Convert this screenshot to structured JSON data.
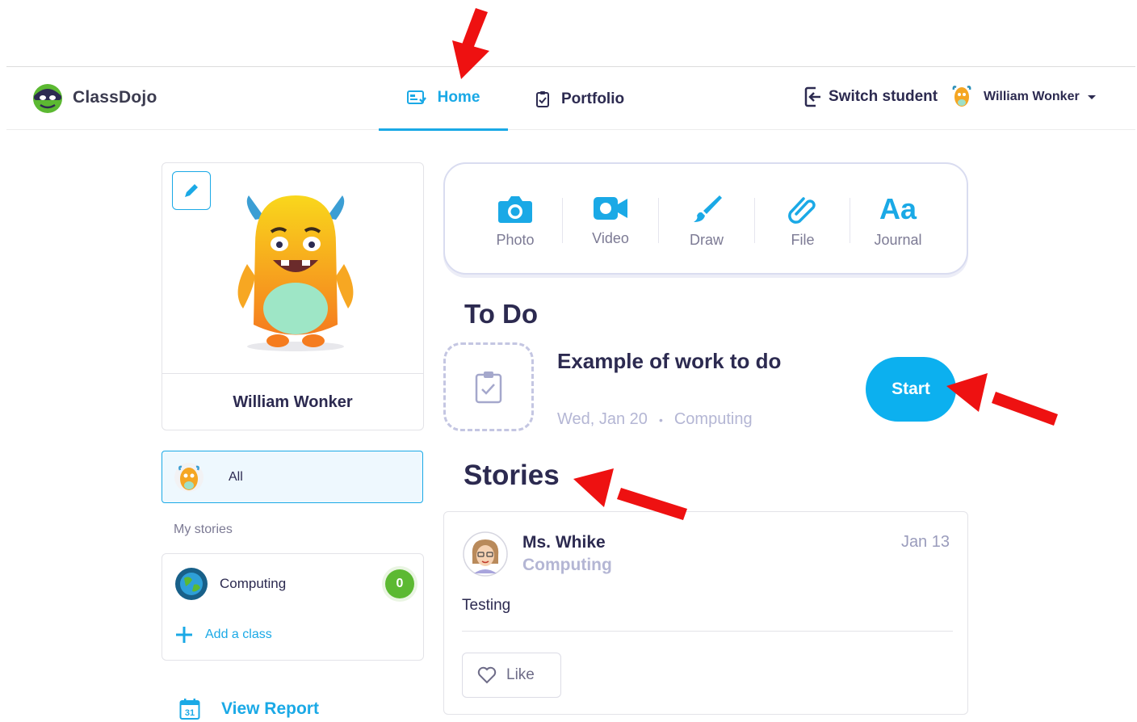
{
  "header": {
    "logo_text": "ClassDojo",
    "tabs": [
      {
        "label": "Home",
        "icon": "home-icon",
        "active": true
      },
      {
        "label": "Portfolio",
        "icon": "clipboard-icon",
        "active": false
      }
    ],
    "switch_student_label": "Switch student",
    "user_name": "William Wonker"
  },
  "profile": {
    "name": "William Wonker"
  },
  "filters": {
    "all_label": "All",
    "my_stories_label": "My stories",
    "classes": [
      {
        "name": "Computing",
        "count": "0"
      }
    ],
    "add_class_label": "Add a class",
    "view_report_label": "View Report",
    "calendar_day": "31"
  },
  "composer": {
    "tools": [
      {
        "label": "Photo",
        "icon": "camera-icon"
      },
      {
        "label": "Video",
        "icon": "video-camera-icon"
      },
      {
        "label": "Draw",
        "icon": "paintbrush-icon"
      },
      {
        "label": "File",
        "icon": "paperclip-icon"
      },
      {
        "label": "Journal",
        "icon": "text-aa-icon",
        "glyph": "Aa"
      }
    ]
  },
  "todo": {
    "title": "To Do",
    "item_title": "Example of work to do",
    "date": "Wed, Jan 20",
    "separator": "•",
    "class_name": "Computing",
    "start_label": "Start"
  },
  "stories": {
    "title": "Stories",
    "items": [
      {
        "author": "Ms. Whike",
        "class_name": "Computing",
        "date": "Jan 13",
        "text": "Testing",
        "like_label": "Like"
      }
    ]
  },
  "colors": {
    "accent": "#1aa9e6",
    "primary_text": "#2c2a50",
    "muted_text": "#b4b6d4",
    "badge_green": "#5cb932",
    "annotation_arrow": "#ee1111"
  }
}
